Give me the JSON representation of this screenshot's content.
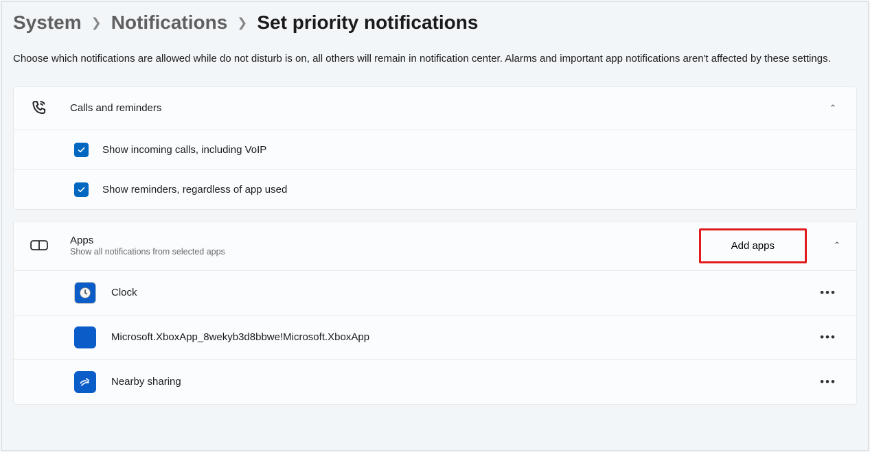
{
  "breadcrumb": {
    "system": "System",
    "notifications": "Notifications",
    "current": "Set priority notifications"
  },
  "description": "Choose which notifications are allowed while do not disturb is on, all others will remain in notification center. Alarms and important app notifications aren't affected by these settings.",
  "calls_section": {
    "title": "Calls and reminders",
    "items": [
      {
        "label": "Show incoming calls, including VoIP",
        "checked": true
      },
      {
        "label": "Show reminders, regardless of app used",
        "checked": true
      }
    ]
  },
  "apps_section": {
    "title": "Apps",
    "subtitle": "Show all notifications from selected apps",
    "add_button": "Add apps",
    "items": [
      {
        "name": "Clock",
        "icon": "clock"
      },
      {
        "name": "Microsoft.XboxApp_8wekyb3d8bbwe!Microsoft.XboxApp",
        "icon": "xbox"
      },
      {
        "name": "Nearby sharing",
        "icon": "nearby"
      }
    ]
  }
}
